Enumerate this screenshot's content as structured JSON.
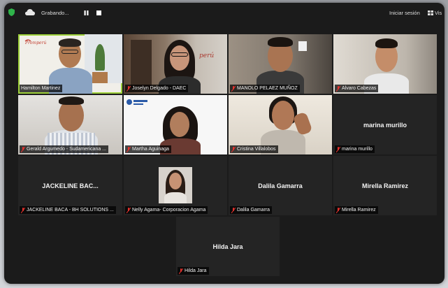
{
  "toolbar": {
    "recording_label": "Grabando...",
    "signin_label": "Iniciar sesión",
    "view_label": "Vis"
  },
  "colors": {
    "active_speaker": "#9ed13a",
    "muted_icon": "#e5322d",
    "tile_bg": "#242424"
  },
  "participants": [
    {
      "name": "Hamilton Martinez",
      "video": true,
      "active": true,
      "muted": false
    },
    {
      "name": "Joselyn Delgado - DAEC",
      "video": true,
      "muted": true
    },
    {
      "name": "MANOLO PELAEZ MUÑOZ",
      "video": true,
      "muted": true
    },
    {
      "name": "Alvaro Cabezas",
      "video": true,
      "muted": true
    },
    {
      "name": "Gerald Argumedo - Sudamericana ...",
      "video": true,
      "muted": true
    },
    {
      "name": "Martha Aguinaga",
      "video": true,
      "muted": true
    },
    {
      "name": "Cristina Villalobos",
      "video": true,
      "muted": true
    },
    {
      "name": "marina murillo",
      "display": "marina murillo",
      "video": false,
      "muted": true
    },
    {
      "name": "JACKELINE BACA - BH SOLUTIONS ...",
      "display": "JACKELINE  BAC...",
      "video": false,
      "muted": true
    },
    {
      "name": "Nelly Agama- Corporacion Agama",
      "video": false,
      "photo": true,
      "muted": true
    },
    {
      "name": "Dalila Gamarra",
      "display": "Dalila Gamarra",
      "video": false,
      "muted": true
    },
    {
      "name": "Mirella Ramirez",
      "display": "Mirella Ramirez",
      "video": false,
      "muted": true
    },
    {
      "name": "Hilda Jara",
      "display": "Hilda Jara",
      "video": false,
      "muted": true
    }
  ],
  "backgrounds": {
    "promperu_logo": "Promperú",
    "peru_wall_text": "perú",
    "peru_wall_text2": "Perú"
  }
}
